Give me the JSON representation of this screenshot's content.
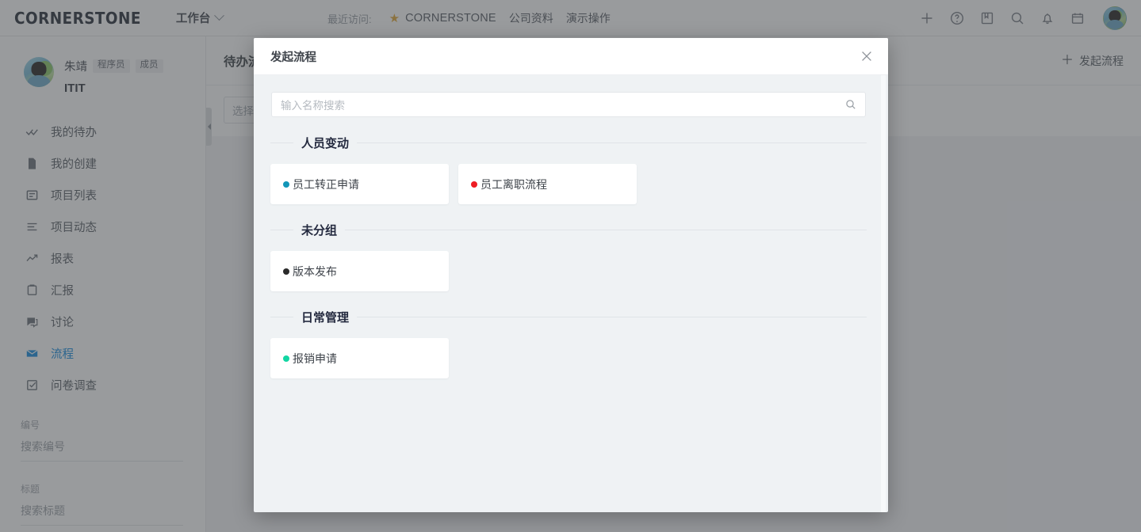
{
  "topbar": {
    "brand": "CORNERSTONE",
    "workspace": "工作台",
    "recent_label": "最近访问:",
    "star_glyph": "★",
    "recent_links": [
      "CORNERSTONE",
      "公司资料",
      "演示操作"
    ],
    "icons": [
      "plus-icon",
      "help-circle-icon",
      "book-icon",
      "search-icon",
      "bell-icon",
      "calendar-icon"
    ]
  },
  "sidebar": {
    "user_name": "朱靖",
    "tags": [
      "程序员",
      "成员"
    ],
    "team": "ITIT",
    "items": [
      {
        "label": "我的待办",
        "icon": "double-check-icon",
        "active": false
      },
      {
        "label": "我的创建",
        "icon": "file-icon",
        "active": false
      },
      {
        "label": "项目列表",
        "icon": "list-box-icon",
        "active": false
      },
      {
        "label": "项目动态",
        "icon": "activity-lines-icon",
        "active": false
      },
      {
        "label": "报表",
        "icon": "trend-up-icon",
        "active": false
      },
      {
        "label": "汇报",
        "icon": "clipboard-icon",
        "active": false
      },
      {
        "label": "讨论",
        "icon": "comment-icon",
        "active": false
      },
      {
        "label": "流程",
        "icon": "envelope-icon",
        "active": true
      },
      {
        "label": "问卷调查",
        "icon": "checkbox-survey-icon",
        "active": false
      }
    ],
    "filters": [
      {
        "label": "编号",
        "placeholder": "搜索编号",
        "value": ""
      },
      {
        "label": "标题",
        "placeholder": "搜索标题",
        "value": ""
      }
    ],
    "active_color": "#1c8fe0"
  },
  "main": {
    "page_title": "待办流程",
    "start_button": "发起流程",
    "select_placeholder": "选择流程"
  },
  "modal": {
    "title": "发起流程",
    "close_icon": "close-icon",
    "search": {
      "placeholder": "输入名称搜索",
      "value": "",
      "icon": "search-icon"
    },
    "groups": [
      {
        "title": "人员变动",
        "items": [
          {
            "label": "员工转正申请",
            "color": "#1296b8"
          },
          {
            "label": "员工离职流程",
            "color": "#ee1c23"
          }
        ]
      },
      {
        "title": "未分组",
        "items": [
          {
            "label": "版本发布",
            "color": "#2b2b2b"
          }
        ]
      },
      {
        "title": "日常管理",
        "items": [
          {
            "label": "报销申请",
            "color": "#12d6a3"
          }
        ]
      }
    ]
  }
}
